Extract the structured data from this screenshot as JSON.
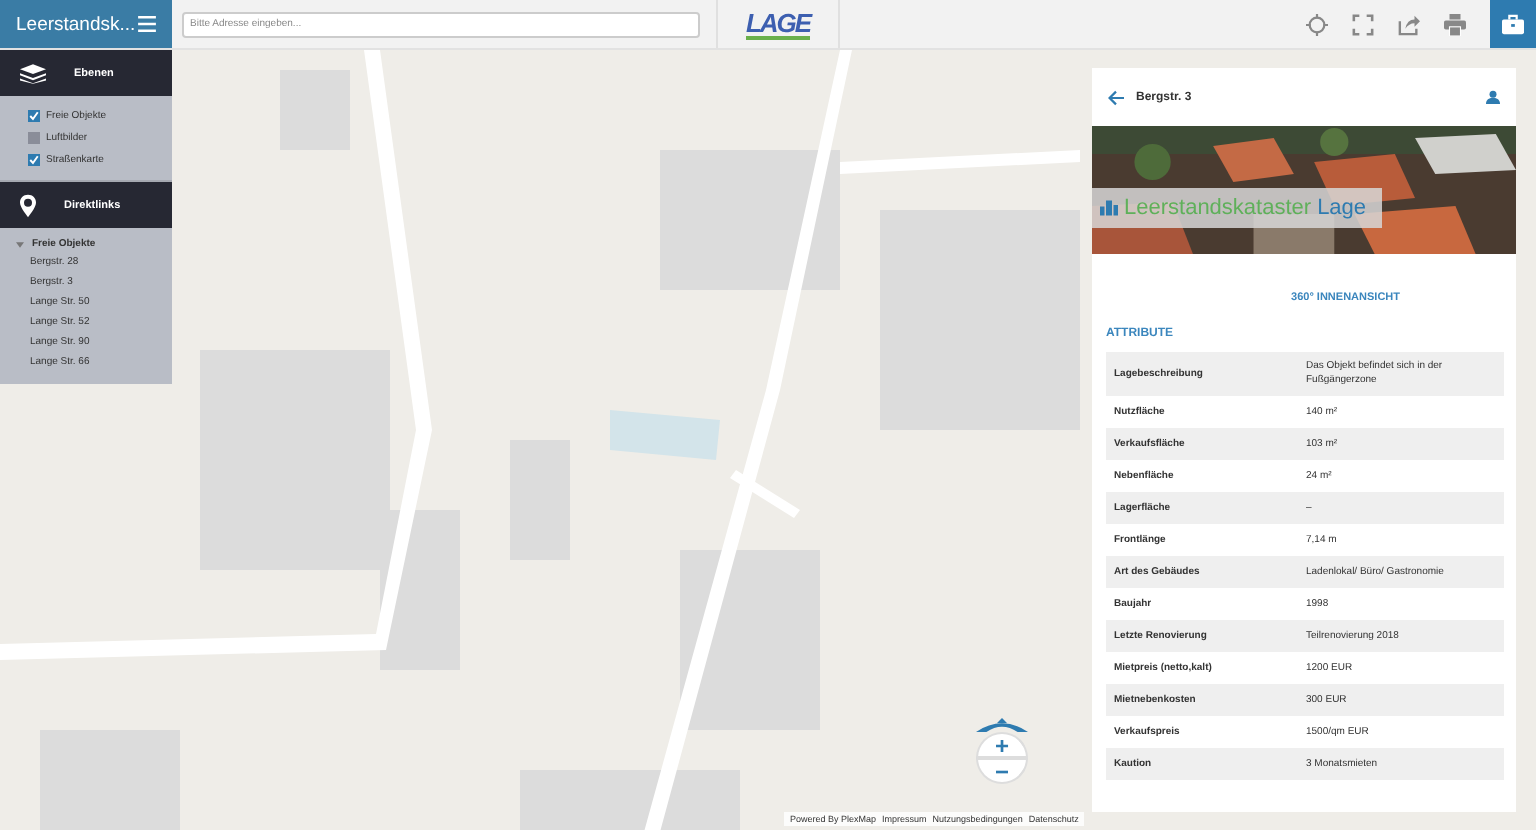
{
  "app": {
    "title": "Leerstandsk..."
  },
  "search": {
    "placeholder": "Bitte Adresse eingeben..."
  },
  "logo": {
    "text": "LAGE"
  },
  "tools": [
    {
      "kind": "locate",
      "selected": false
    },
    {
      "kind": "fullscreen",
      "selected": false
    },
    {
      "kind": "share",
      "selected": false
    },
    {
      "kind": "print",
      "selected": false
    },
    {
      "kind": "briefcase",
      "selected": true
    }
  ],
  "sidebar": {
    "layers": {
      "title": "Ebenen",
      "items": [
        {
          "label": "Freie Objekte",
          "checked": true
        },
        {
          "label": "Luftbilder",
          "checked": false
        },
        {
          "label": "Straßenkarte",
          "checked": true
        }
      ]
    },
    "links": {
      "title": "Direktlinks",
      "tree": [
        {
          "label": "Freie Objekte",
          "expanded": true,
          "children": [
            {
              "label": "Bergstr. 28"
            },
            {
              "label": "Bergstr. 3"
            },
            {
              "label": "Lange Str. 50"
            },
            {
              "label": "Lange Str. 52"
            },
            {
              "label": "Lange Str. 90"
            },
            {
              "label": "Lange Str. 66"
            }
          ]
        }
      ]
    }
  },
  "panel": {
    "title": "Bergstr. 3",
    "banner": {
      "title": "Leerstandskataster",
      "accent": "Lage"
    },
    "link": "360° INNENANSICHT",
    "section": "ATTRIBUTE",
    "rows": [
      {
        "label": "Lagebeschreibung",
        "value": "Das Objekt befindet sich in der Fußgängerzone"
      },
      {
        "label": "Nutzfläche",
        "value": "140 m²"
      },
      {
        "label": "Verkaufsfläche",
        "value": "103 m²"
      },
      {
        "label": "Nebenfläche",
        "value": "24 m²"
      },
      {
        "label": "Lagerfläche",
        "value": "–"
      },
      {
        "label": "Frontlänge",
        "value": "7,14 m"
      },
      {
        "label": "Art des Gebäudes",
        "value": "Ladenlokal/ Büro/ Gastronomie"
      },
      {
        "label": "Baujahr",
        "value": "1998"
      },
      {
        "label": "Letzte Renovierung",
        "value": "Teilrenovierung 2018"
      },
      {
        "label": "Mietpreis (netto,kalt)",
        "value": "1200 EUR"
      },
      {
        "label": "Mietnebenkosten",
        "value": "300 EUR"
      },
      {
        "label": "Verkaufspreis",
        "value": "1500/qm EUR"
      },
      {
        "label": "Kaution",
        "value": "3 Monatsmieten"
      }
    ]
  },
  "zoom": {
    "in": "+",
    "out": "−"
  },
  "attribution": [
    "Powered By PlexMap",
    "Impressum",
    "Nutzungsbedingungen",
    "Datenschutz"
  ]
}
